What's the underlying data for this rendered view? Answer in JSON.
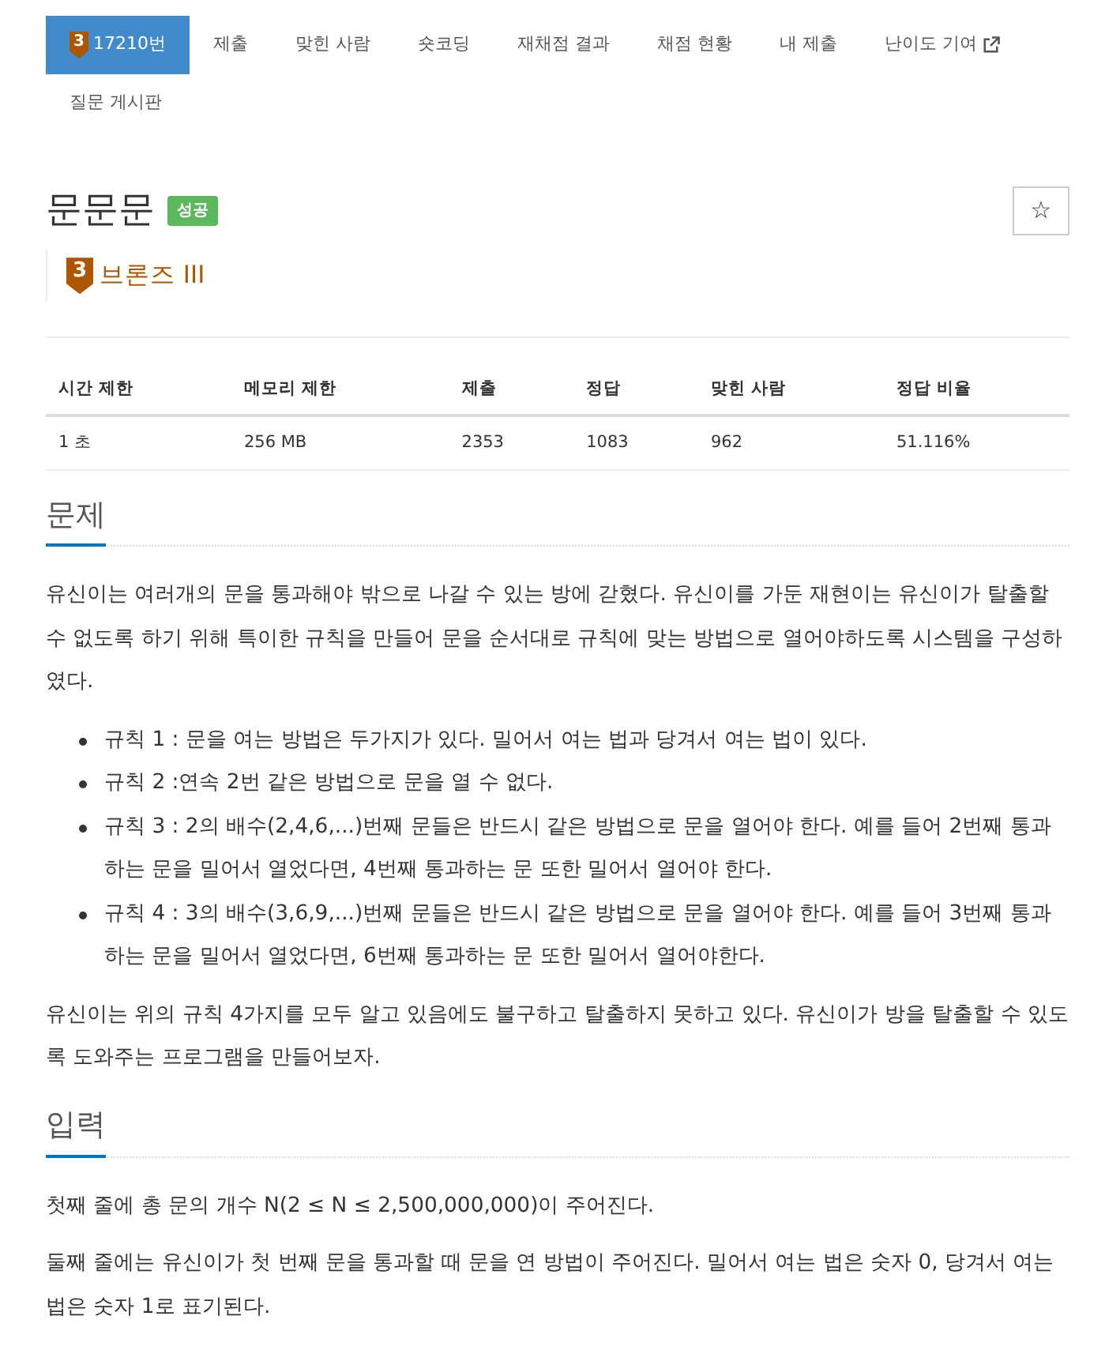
{
  "tabs": [
    {
      "label": "17210번",
      "kind": "problem",
      "tier_digit": "3",
      "selected": true
    },
    {
      "label": "제출",
      "kind": "plain",
      "selected": false
    },
    {
      "label": "맞힌 사람",
      "kind": "plain",
      "selected": false
    },
    {
      "label": "숏코딩",
      "kind": "plain",
      "selected": false
    },
    {
      "label": "재채점 결과",
      "kind": "plain",
      "selected": false
    },
    {
      "label": "채점 현황",
      "kind": "plain",
      "selected": false
    },
    {
      "label": "내 제출",
      "kind": "plain",
      "selected": false
    },
    {
      "label": "난이도 기여",
      "kind": "external",
      "selected": false
    },
    {
      "label": "질문 게시판",
      "kind": "plain",
      "selected": false
    }
  ],
  "problem": {
    "title": "문문문",
    "result_label": "성공",
    "favorite_button": "☆",
    "tier": {
      "digit": "3",
      "name": "브론즈 III"
    }
  },
  "info_table": {
    "columns": [
      "시간 제한",
      "메모리 제한",
      "제출",
      "정답",
      "맞힌 사람",
      "정답 비율"
    ],
    "rows": [
      [
        "1 초",
        "256 MB",
        "2353",
        "1083",
        "962",
        "51.116%"
      ]
    ]
  },
  "sections": [
    {
      "heading": "문제",
      "blocks": [
        {
          "kind": "paragraph",
          "text": "유신이는 여러개의 문을 통과해야 밖으로 나갈 수 있는 방에 갇혔다. 유신이를 가둔 재현이는 유신이가 탈출할 수 없도록 하기 위해 특이한 규칙을 만들어 문을 순서대로 규칙에 맞는 방법으로 열어야하도록 시스템을 구성하였다."
        },
        {
          "kind": "list",
          "items": [
            "규칙 1 : 문을 여는 방법은 두가지가 있다. 밀어서 여는 법과 당겨서 여는 법이 있다.",
            "규칙 2 :연속 2번 같은 방법으로 문을 열 수 없다.",
            "규칙 3 : 2의 배수(2,4,6,...)번째 문들은 반드시 같은 방법으로 문을 열어야 한다. 예를 들어 2번째 통과하는 문을 밀어서 열었다면, 4번째 통과하는 문 또한 밀어서 열어야 한다.",
            "규칙 4 : 3의 배수(3,6,9,...)번째 문들은 반드시 같은 방법으로 문을 열어야 한다. 예를 들어 3번째 통과하는 문을 밀어서 열었다면, 6번째 통과하는 문 또한 밀어서 열어야한다."
          ]
        },
        {
          "kind": "paragraph",
          "text": "유신이는 위의 규칙 4가지를 모두 알고 있음에도 불구하고 탈출하지 못하고 있다. 유신이가 방을 탈출할 수 있도록 도와주는 프로그램을 만들어보자."
        }
      ]
    },
    {
      "heading": "입력",
      "blocks": [
        {
          "kind": "paragraph",
          "text": "첫째 줄에 총 문의 개수 N(2 ≤ N ≤ 2,500,000,000)이 주어진다."
        },
        {
          "kind": "paragraph",
          "text": "둘째 줄에는 유신이가 첫 번째 문을 통과할 때 문을 연 방법이 주어진다. 밀어서 여는 법은 숫자 0, 당겨서 여는 법은 숫자 1로 표기된다."
        }
      ]
    }
  ]
}
